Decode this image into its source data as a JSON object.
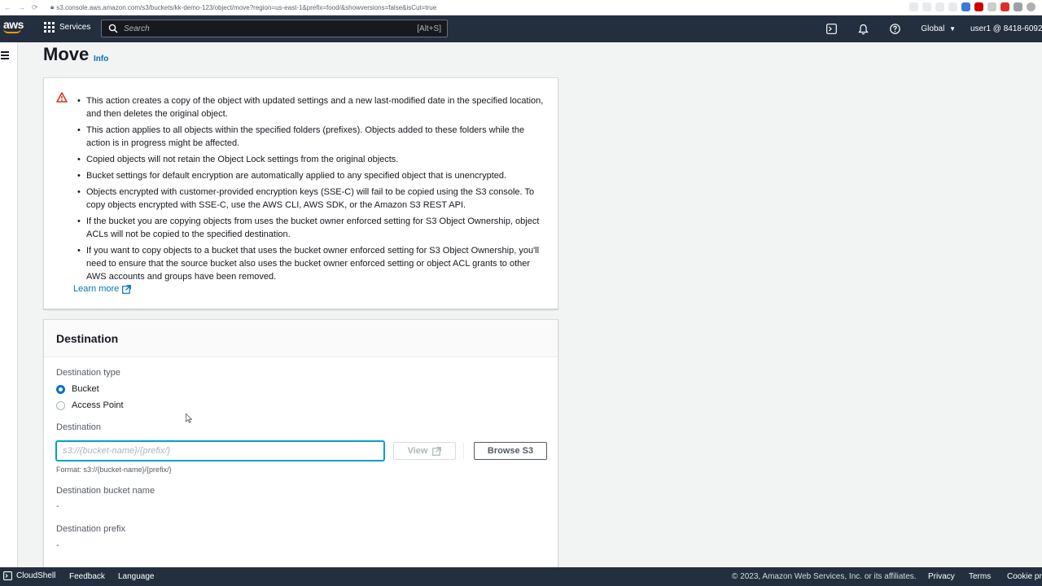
{
  "browser": {
    "url": "s3.console.aws.amazon.com/s3/buckets/kk-demo-123/object/move?region=us-east-1&prefix=food/&showversions=false&isCut=true"
  },
  "topnav": {
    "logo": "aws",
    "services_label": "Services",
    "search_placeholder": "Search",
    "search_shortcut": "[Alt+S]",
    "region": "Global",
    "account": "user1 @ 8418-6092"
  },
  "page": {
    "title": "Move",
    "info": "Info"
  },
  "warning": {
    "items": [
      "This action creates a copy of the object with updated settings and a new last-modified date in the specified location, and then deletes the original object.",
      "This action applies to all objects within the specified folders (prefixes). Objects added to these folders while the action is in progress might be affected.",
      "Copied objects will not retain the Object Lock settings from the original objects.",
      "Bucket settings for default encryption are automatically applied to any specified object that is unencrypted.",
      "Objects encrypted with customer-provided encryption keys (SSE-C) will fail to be copied using the S3 console. To copy objects encrypted with SSE-C, use the AWS CLI, AWS SDK, or the Amazon S3 REST API.",
      "If the bucket you are copying objects from uses the bucket owner enforced setting for S3 Object Ownership, object ACLs will not be copied to the specified destination.",
      "If you want to copy objects to a bucket that uses the bucket owner enforced setting for S3 Object Ownership, you'll need to ensure that the source bucket also uses the bucket owner enforced setting or object ACL grants to other AWS accounts and groups have been removed."
    ],
    "learn_more": "Learn more"
  },
  "destination": {
    "title": "Destination",
    "type_label": "Destination type",
    "options": [
      "Bucket",
      "Access Point"
    ],
    "selected": "Bucket",
    "field_label": "Destination",
    "field_value": "",
    "field_placeholder": "s3://{bucket-name}/{prefix/}",
    "view_label": "View",
    "browse_label": "Browse S3",
    "format_hint": "Format: s3://{bucket-name}/{prefix/}",
    "bucket_name_label": "Destination bucket name",
    "bucket_name_value": "-",
    "prefix_label": "Destination prefix",
    "prefix_value": "-"
  },
  "footer": {
    "cloudshell": "CloudShell",
    "feedback": "Feedback",
    "language": "Language",
    "copyright": "© 2023, Amazon Web Services, Inc. or its affiliates.",
    "privacy": "Privacy",
    "terms": "Terms",
    "cookie": "Cookie preferences"
  },
  "colors": {
    "nav_bg": "#232f3e",
    "link": "#0073bb",
    "warning_icon": "#d13212",
    "focus": "#00a1c9"
  }
}
